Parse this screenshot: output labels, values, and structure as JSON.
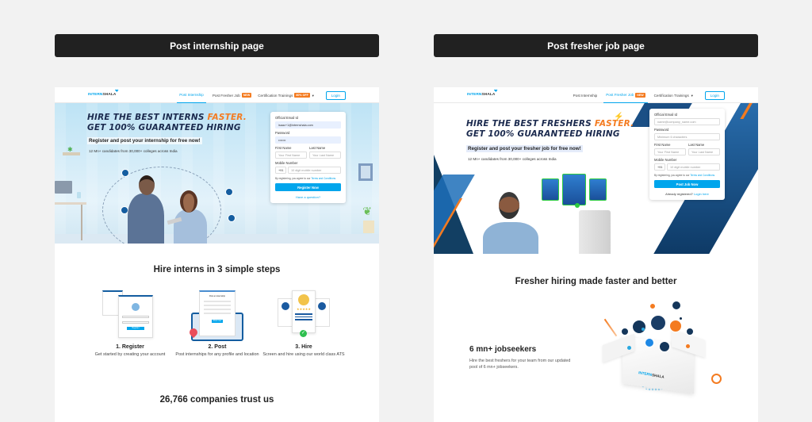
{
  "banners": {
    "left": "Post internship page",
    "right": "Post fresher job page"
  },
  "common": {
    "logo_part1": "INTERN",
    "logo_part2": "SHALA",
    "nav": {
      "post_internship": "Post Internship",
      "post_fresher_job": "Post Fresher Job",
      "new_badge": "NEW",
      "certification": "Certification Trainings",
      "cert_badge": "80% OFF",
      "login": "Login"
    },
    "meta": "12 Mn+ candidates from 30,000+ colleges across India",
    "title_line2": "GET 100% GUARANTEED HIRING",
    "title_accent": "FASTER.",
    "terms_prefix": "By registering, you agree to our",
    "terms_link": "Terms and Conditions.",
    "accent_color": "#00a5ec",
    "orange_color": "#f47b20"
  },
  "internship_page": {
    "title_line1": "HIRE THE BEST INTERNS",
    "subtitle": "Register and post your internship for free now!",
    "form": {
      "email_label": "Official Email Id",
      "email_value": "isaac+1@internshala.com",
      "password_label": "Password",
      "password_value": "•••••••",
      "first_name_label": "First Name",
      "first_name_placeholder": "Your First Name",
      "last_name_label": "Last Name",
      "last_name_placeholder": "Your Last Name",
      "mobile_label": "Mobile Number",
      "country_code": "+91",
      "mobile_placeholder": "10 digit mobile number",
      "submit": "Register Now",
      "footer_link": "Have a question?"
    },
    "steps_title": "Hire interns in 3 simple steps",
    "steps": [
      {
        "title": "1. Register",
        "desc": "Get started by creating your account"
      },
      {
        "title": "2. Post",
        "desc": "Post internships for any profile and location"
      },
      {
        "title": "3. Hire",
        "desc": "Screen and hire using our world class ATS"
      }
    ],
    "step2_card_title": "Post an internship",
    "step1_button": "Register",
    "step2_button": "Post now",
    "trust_title": "26,766 companies trust us"
  },
  "fresher_page": {
    "title_line1": "HIRE THE BEST FRESHERS",
    "subtitle": "Register and post your fresher job for free now!",
    "form": {
      "email_label": "Official Email Id",
      "email_placeholder": "name@company_name.com",
      "password_label": "Password",
      "password_placeholder": "Minimum 6 characters",
      "first_name_label": "First Name",
      "first_name_placeholder": "Your First Name",
      "last_name_label": "Last Name",
      "last_name_placeholder": "Your Last Name",
      "mobile_label": "Mobile Number",
      "country_code": "+91",
      "mobile_placeholder": "10 digit mobile number",
      "submit": "Post Job Now",
      "footer_text": "Already registered?",
      "footer_link": "Login here"
    },
    "section_title": "Fresher hiring made faster and better",
    "seekers_title": "6 mn+ jobseekers",
    "seekers_desc": "Hire the best freshers for your team from our updated pool of 6 mn+ jobseekers."
  }
}
